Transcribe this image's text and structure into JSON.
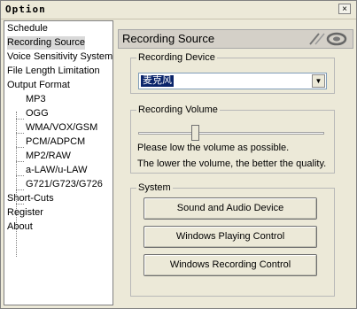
{
  "window": {
    "title": "Option",
    "close_label": "×"
  },
  "sidebar": {
    "items": [
      {
        "label": "Schedule"
      },
      {
        "label": "Recording Source"
      },
      {
        "label": "Voice Sensitivity System"
      },
      {
        "label": "File Length Limitation"
      },
      {
        "label": "Output Format"
      },
      {
        "label": "MP3"
      },
      {
        "label": "OGG"
      },
      {
        "label": "WMA/VOX/GSM"
      },
      {
        "label": "PCM/ADPCM"
      },
      {
        "label": "MP2/RAW"
      },
      {
        "label": "a-LAW/u-LAW"
      },
      {
        "label": "G721/G723/G726"
      },
      {
        "label": "Short-Cuts"
      },
      {
        "label": "Register"
      },
      {
        "label": "About"
      }
    ],
    "selected": "Recording Source"
  },
  "panel": {
    "title": "Recording Source",
    "recording_device": {
      "label": "Recording Device",
      "value": "麦克风"
    },
    "recording_volume": {
      "label": "Recording Volume",
      "level": 0.3,
      "hint1": "Please low the volume as possible.",
      "hint2": "The lower the volume, the better the quality."
    },
    "system": {
      "label": "System",
      "buttons": [
        "Sound and Audio Device",
        "Windows Playing Control",
        "Windows Recording Control"
      ]
    }
  }
}
